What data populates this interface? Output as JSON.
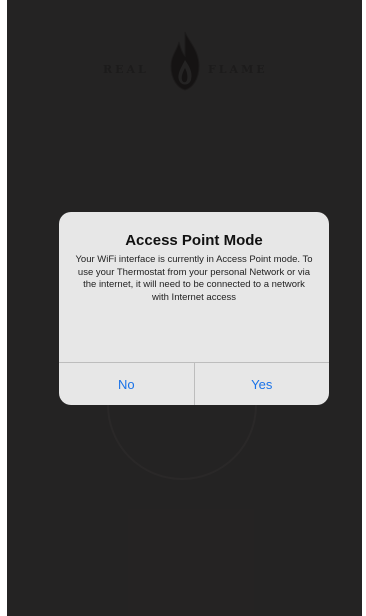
{
  "logo": {
    "left_text": "REAL",
    "right_text": "FLAME"
  },
  "alert": {
    "title": "Access Point Mode",
    "message": "Your WiFi interface is currently in Access Point mode. To use your Thermostat from your personal Network or via the internet, it will need to be connected to a network with Internet access",
    "buttons": {
      "no": "No",
      "yes": "Yes"
    }
  },
  "colors": {
    "background": "#363434",
    "alert_background": "#e7e7e7",
    "button_text": "#1a73e8"
  }
}
